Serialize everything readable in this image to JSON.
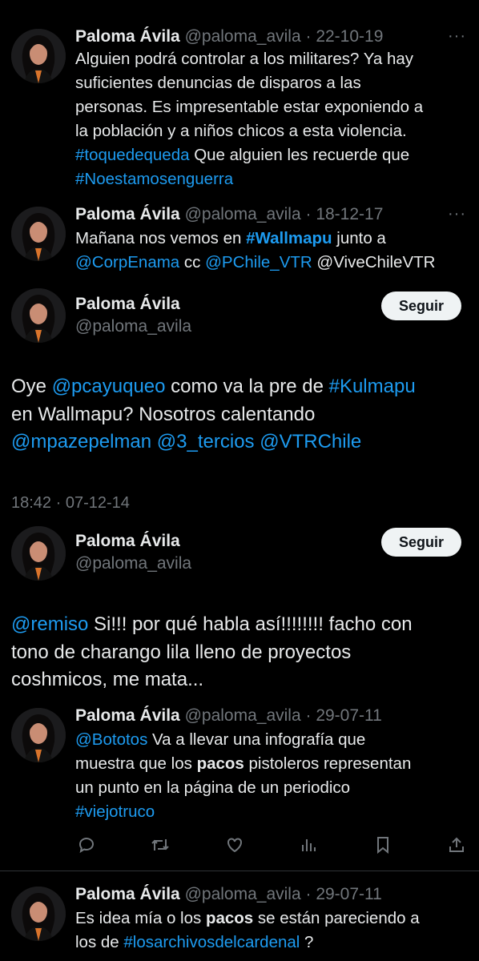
{
  "tweets": [
    {
      "name": "Paloma Ávila",
      "handle": "@paloma_avila",
      "date": "22-10-19",
      "lines": [
        [
          {
            "t": "Alguien podrá controlar a los militares? Ya hay"
          }
        ],
        [
          {
            "t": "suficientes denuncias de disparos a las"
          }
        ],
        [
          {
            "t": "personas. Es impresentable estar exponiendo a"
          }
        ],
        [
          {
            "t": "la población y a niños chicos a esta violencia."
          }
        ],
        [
          {
            "t": "#toquedequeda",
            "c": "link"
          },
          {
            "t": " Que alguien les recuerde que"
          }
        ],
        [
          {
            "t": "#Noestamosenguerra",
            "c": "link"
          }
        ]
      ]
    },
    {
      "name": "Paloma Ávila",
      "handle": "@paloma_avila",
      "date": "18-12-17",
      "lines": [
        [
          {
            "t": "Mañana nos vemos en "
          },
          {
            "t": "#Wallmapu",
            "c": "link bold"
          },
          {
            "t": " junto a"
          }
        ],
        [
          {
            "t": "@CorpEnama",
            "c": "link"
          },
          {
            "t": " cc "
          },
          {
            "t": "@PChile_VTR",
            "c": "link"
          },
          {
            "t": " @ViveChileVTR"
          }
        ]
      ]
    },
    {
      "name": "Paloma Ávila",
      "handle": "@paloma_avila",
      "follow": "Seguir",
      "timestamp": "18:42 · 07-12-14",
      "lines": [
        [
          {
            "t": "Oye "
          },
          {
            "t": "@pcayuqueo",
            "c": "link"
          },
          {
            "t": " como va la pre de "
          },
          {
            "t": "#Kulmapu",
            "c": "link"
          }
        ],
        [
          {
            "t": "en Wallmapu? Nosotros calentando"
          }
        ],
        [
          {
            "t": "@mpazepelman",
            "c": "link"
          },
          {
            "t": " "
          },
          {
            "t": "@3_tercios",
            "c": "link"
          },
          {
            "t": " "
          },
          {
            "t": "@VTRChile",
            "c": "link"
          }
        ]
      ]
    },
    {
      "name": "Paloma Ávila",
      "handle": "@paloma_avila",
      "follow": "Seguir",
      "lines": [
        [
          {
            "t": "@remiso",
            "c": "link"
          },
          {
            "t": " Si!!! por qué habla así!!!!!!!! facho con"
          }
        ],
        [
          {
            "t": "tono de charango lila lleno de proyectos"
          }
        ],
        [
          {
            "t": "coshmicos, me mata..."
          }
        ]
      ]
    },
    {
      "name": "Paloma Ávila",
      "handle": "@paloma_avila",
      "date": "29-07-11",
      "lines": [
        [
          {
            "t": "@Bototos",
            "c": "link"
          },
          {
            "t": " Va a llevar una infografía que"
          }
        ],
        [
          {
            "t": "muestra que los "
          },
          {
            "t": "pacos",
            "c": "bold"
          },
          {
            "t": " pistoleros representan"
          }
        ],
        [
          {
            "t": "un punto en la página de un periodico"
          }
        ],
        [
          {
            "t": "#viejotruco",
            "c": "link"
          }
        ]
      ]
    },
    {
      "name": "Paloma Ávila",
      "handle": "@paloma_avila",
      "date": "29-07-11",
      "lines": [
        [
          {
            "t": "Es idea mía o los "
          },
          {
            "t": "pacos",
            "c": "bold"
          },
          {
            "t": " se están pareciendo a"
          }
        ],
        [
          {
            "t": "los de "
          },
          {
            "t": "#losarchivosdelcardenal",
            "c": "link"
          },
          {
            "t": " ?"
          }
        ]
      ]
    }
  ],
  "sep": " · ",
  "more": "···",
  "colors": {
    "link": "#1d9bf0",
    "muted": "#71767b",
    "text": "#e7e9ea",
    "bg": "#000000"
  },
  "icons": [
    "reply-icon",
    "retweet-icon",
    "like-icon",
    "views-icon",
    "bookmark-icon",
    "share-icon"
  ]
}
